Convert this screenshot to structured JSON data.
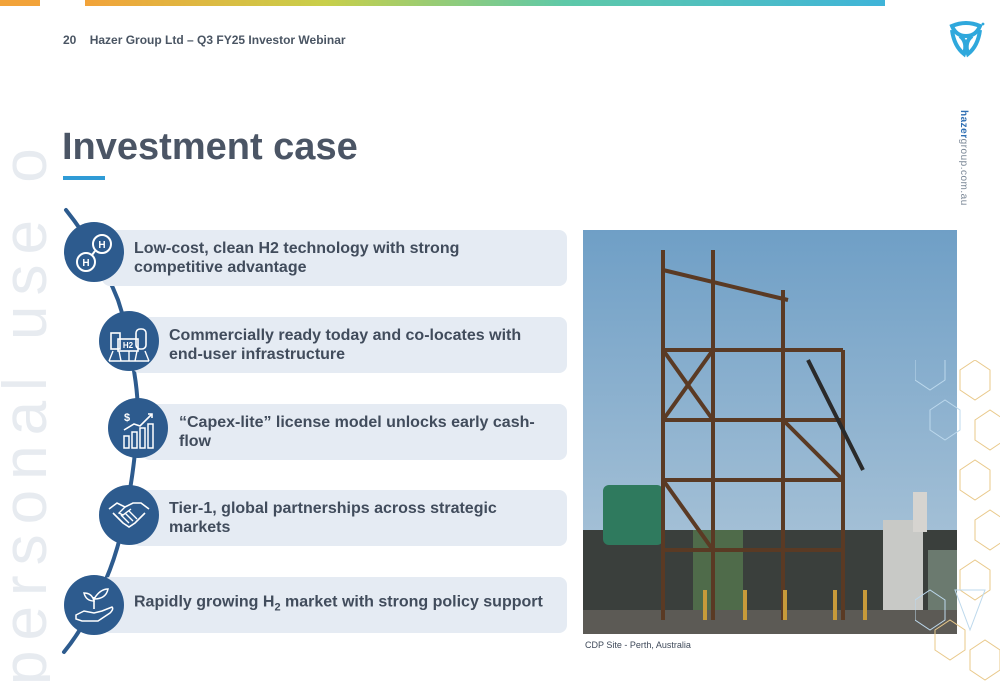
{
  "header": {
    "page_number": "20",
    "title": "Hazer Group Ltd – Q3 FY25 Investor Webinar"
  },
  "side_url": {
    "bold": "hazer",
    "rest": "group.com.au"
  },
  "watermark": "personal use only",
  "slide_title": "Investment case",
  "items": [
    {
      "label": "Low-cost, clean H2 technology with strong competitive advantage",
      "icon": "hydrogen-molecule-icon"
    },
    {
      "label": "Commercially ready today and co-locates with end-user infrastructure",
      "icon": "h2-plant-icon"
    },
    {
      "label": "“Capex-lite” license model unlocks early cash-flow",
      "icon": "growth-chart-icon"
    },
    {
      "label": "Tier-1, global partnerships across strategic markets",
      "icon": "handshake-icon"
    },
    {
      "label_pre": "Rapidly growing H",
      "label_sub": "2",
      "label_post": " market with strong policy support",
      "icon": "plant-in-hand-icon"
    }
  ],
  "photo_caption": "CDP Site - Perth, Australia",
  "colors": {
    "icon_fill": "#2d5b8e",
    "item_bg": "#e5ebf3",
    "accent": "#2f9bd6",
    "title": "#4b5565"
  }
}
